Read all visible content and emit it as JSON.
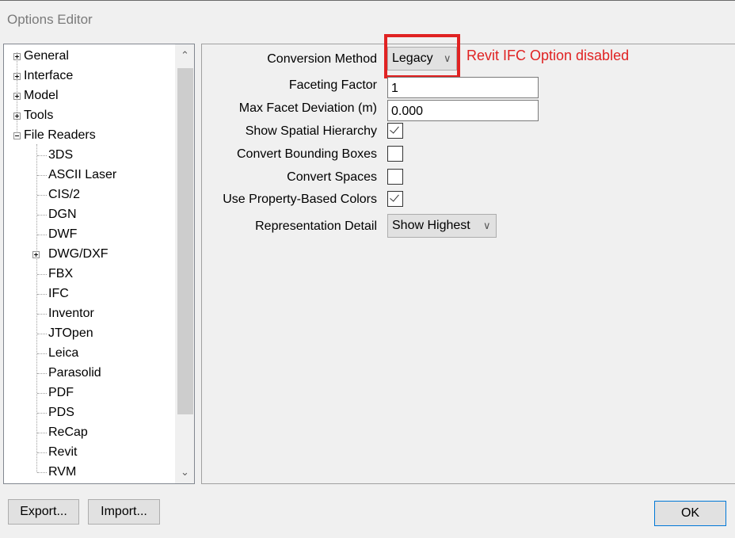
{
  "window": {
    "title": "Options Editor"
  },
  "tree": {
    "items": [
      {
        "label": "General",
        "expander": "plus"
      },
      {
        "label": "Interface",
        "expander": "plus"
      },
      {
        "label": "Model",
        "expander": "plus"
      },
      {
        "label": "Tools",
        "expander": "plus"
      },
      {
        "label": "File Readers",
        "expander": "minus"
      },
      {
        "label": "3DS"
      },
      {
        "label": "ASCII Laser"
      },
      {
        "label": "CIS/2"
      },
      {
        "label": "DGN"
      },
      {
        "label": "DWF"
      },
      {
        "label": "DWG/DXF",
        "expander": "plus"
      },
      {
        "label": "FBX"
      },
      {
        "label": "IFC"
      },
      {
        "label": "Inventor"
      },
      {
        "label": "JTOpen"
      },
      {
        "label": "Leica"
      },
      {
        "label": "Parasolid"
      },
      {
        "label": "PDF"
      },
      {
        "label": "PDS"
      },
      {
        "label": "ReCap"
      },
      {
        "label": "Revit"
      },
      {
        "label": "RVM"
      }
    ],
    "scroll_up_icon": "▲",
    "scroll_down_icon": "▼"
  },
  "options": {
    "conversion_method": {
      "label": "Conversion Method",
      "value": "Legacy"
    },
    "faceting_factor": {
      "label": "Faceting Factor",
      "value": "1"
    },
    "max_facet_deviation": {
      "label": "Max Facet Deviation (m)",
      "value": "0.000"
    },
    "show_spatial_hierarchy": {
      "label": "Show Spatial Hierarchy",
      "checked": true
    },
    "convert_bounding_boxes": {
      "label": "Convert Bounding Boxes",
      "checked": false
    },
    "convert_spaces": {
      "label": "Convert Spaces",
      "checked": false
    },
    "use_property_based_colors": {
      "label": "Use Property-Based Colors",
      "checked": true
    },
    "representation_detail": {
      "label": "Representation Detail",
      "value": "Show Highest"
    },
    "annotation": "Revit IFC Option disabled",
    "annotation_color": "#e02222"
  },
  "buttons": {
    "export": "Export...",
    "import": "Import...",
    "ok": "OK"
  },
  "icons": {
    "dropdown": "∨"
  }
}
